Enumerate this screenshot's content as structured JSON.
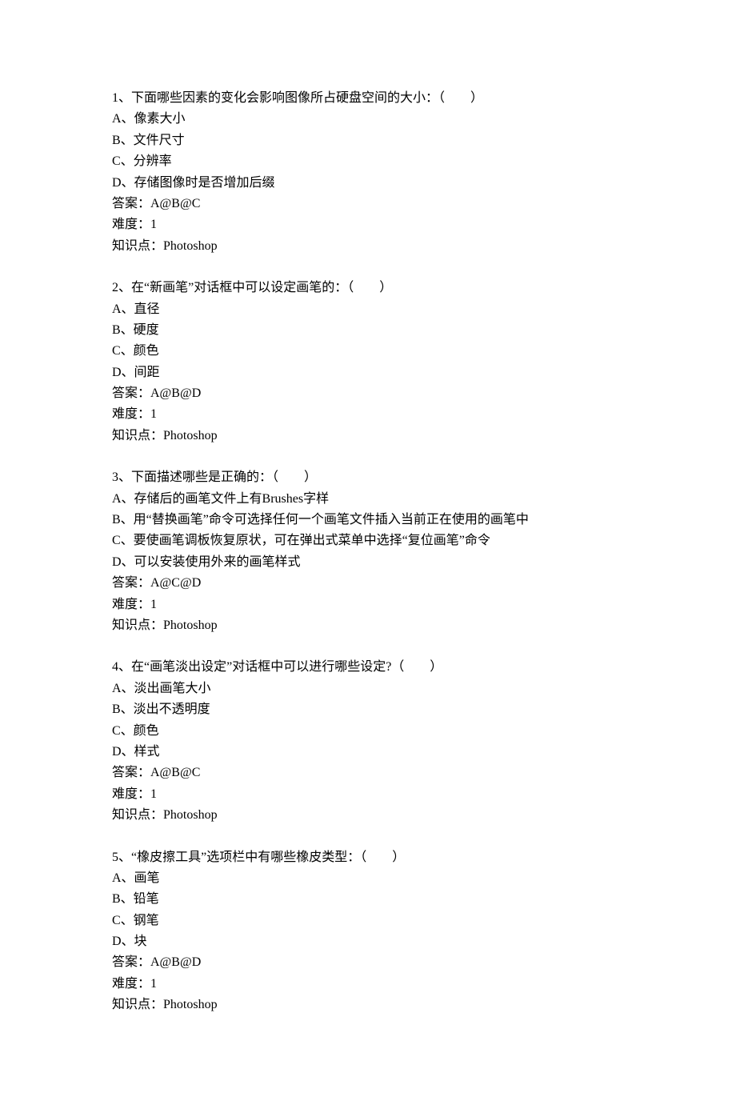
{
  "questions": [
    {
      "stem": "1、下面哪些因素的变化会影响图像所占硬盘空间的大小：（　　）",
      "options": [
        "A、像素大小",
        "B、文件尺寸",
        "C、分辨率",
        "D、存储图像时是否增加后缀"
      ],
      "answer": "答案：A@B@C",
      "difficulty": "难度：1",
      "knowledge": "知识点：Photoshop"
    },
    {
      "stem": "2、在“新画笔”对话框中可以设定画笔的：（　　）",
      "options": [
        "A、直径",
        "B、硬度",
        "C、颜色",
        "D、间距"
      ],
      "answer": "答案：A@B@D",
      "difficulty": "难度：1",
      "knowledge": "知识点：Photoshop"
    },
    {
      "stem": "3、下面描述哪些是正确的：（　　）",
      "options": [
        "A、存储后的画笔文件上有Brushes字样",
        "B、用“替换画笔”命令可选择任何一个画笔文件插入当前正在使用的画笔中",
        "C、要使画笔调板恢复原状，可在弹出式菜单中选择“复位画笔”命令",
        "D、可以安装使用外来的画笔样式"
      ],
      "answer": "答案：A@C@D",
      "difficulty": "难度：1",
      "knowledge": "知识点：Photoshop"
    },
    {
      "stem": "4、在“画笔淡出设定”对话框中可以进行哪些设定?（　　）",
      "options": [
        "A、淡出画笔大小",
        "B、淡出不透明度",
        "C、颜色",
        "D、样式"
      ],
      "answer": "答案：A@B@C",
      "difficulty": "难度：1",
      "knowledge": "知识点：Photoshop"
    },
    {
      "stem": "5、“橡皮擦工具”选项栏中有哪些橡皮类型：（　　）",
      "options": [
        "A、画笔",
        "B、铅笔",
        "C、钢笔",
        "D、块"
      ],
      "answer": "答案：A@B@D",
      "difficulty": "难度：1",
      "knowledge": "知识点：Photoshop"
    }
  ]
}
